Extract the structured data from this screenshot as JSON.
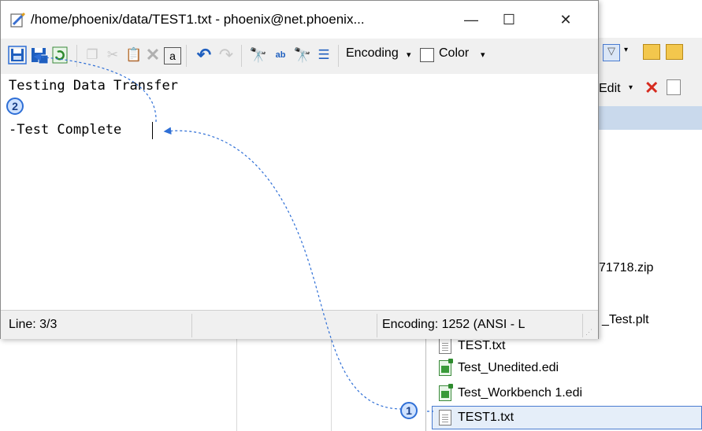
{
  "editor": {
    "title": "/home/phoenix/data/TEST1.txt - phoenix@net.phoenix...",
    "window_controls": {
      "minimize": "—",
      "maximize": "☐",
      "close": "✕"
    },
    "toolbar": {
      "encoding_label": "Encoding",
      "color_label": "Color",
      "overflow": "»"
    },
    "content_lines": [
      "Testing Data Transfer",
      "",
      "-Test Complete"
    ],
    "status": {
      "line": "Line: 3/3",
      "encoding": "Encoding: 1252  (ANSI - L"
    }
  },
  "background": {
    "toolbar2_edit_label": "Edit",
    "partial_files": [
      "71718.zip",
      "_Test.plt"
    ],
    "files": [
      "TEST.txt",
      "Test_Unedited.edi",
      "Test_Workbench 1.edi",
      "TEST1.txt"
    ],
    "selected_file": "TEST1.txt"
  },
  "callouts": {
    "step1": "1",
    "step2": "2"
  },
  "colors": {
    "accent": "#2f6fd6",
    "selection": "#e5eef9"
  }
}
